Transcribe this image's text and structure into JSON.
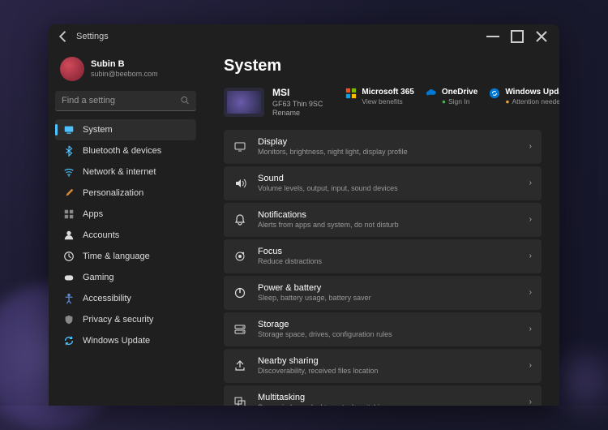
{
  "titlebar": {
    "title": "Settings"
  },
  "profile": {
    "name": "Subin B",
    "email": "subin@beebom.com"
  },
  "search": {
    "placeholder": "Find a setting"
  },
  "sidebar": {
    "items": [
      {
        "icon": "system-icon",
        "label": "System",
        "active": true,
        "color": "#4cc2ff"
      },
      {
        "icon": "bluetooth-icon",
        "label": "Bluetooth & devices",
        "active": false,
        "color": "#4cc2ff"
      },
      {
        "icon": "wifi-icon",
        "label": "Network & internet",
        "active": false,
        "color": "#4cc2ff"
      },
      {
        "icon": "brush-icon",
        "label": "Personalization",
        "active": false,
        "color": "#d68a3a"
      },
      {
        "icon": "apps-icon",
        "label": "Apps",
        "active": false,
        "color": "#888"
      },
      {
        "icon": "accounts-icon",
        "label": "Accounts",
        "active": false,
        "color": "#ddd"
      },
      {
        "icon": "time-icon",
        "label": "Time & language",
        "active": false,
        "color": "#ddd"
      },
      {
        "icon": "gaming-icon",
        "label": "Gaming",
        "active": false,
        "color": "#ddd"
      },
      {
        "icon": "accessibility-icon",
        "label": "Accessibility",
        "active": false,
        "color": "#5a8dd6"
      },
      {
        "icon": "privacy-icon",
        "label": "Privacy & security",
        "active": false,
        "color": "#888"
      },
      {
        "icon": "update-icon",
        "label": "Windows Update",
        "active": false,
        "color": "#4cc2ff"
      }
    ]
  },
  "page": {
    "title": "System"
  },
  "device": {
    "name": "MSI",
    "model": "GF63 Thin 9SC",
    "rename": "Rename"
  },
  "status": [
    {
      "icon": "microsoft-icon",
      "title": "Microsoft 365",
      "sub": "View benefits",
      "dot": ""
    },
    {
      "icon": "onedrive-icon",
      "title": "OneDrive",
      "sub": "Sign In",
      "dot": "green"
    },
    {
      "icon": "update-status-icon",
      "title": "Windows Update",
      "sub": "Attention needed",
      "dot": "amber"
    }
  ],
  "settings": [
    {
      "icon": "display-icon",
      "title": "Display",
      "sub": "Monitors, brightness, night light, display profile"
    },
    {
      "icon": "sound-icon",
      "title": "Sound",
      "sub": "Volume levels, output, input, sound devices"
    },
    {
      "icon": "notifications-icon",
      "title": "Notifications",
      "sub": "Alerts from apps and system, do not disturb"
    },
    {
      "icon": "focus-icon",
      "title": "Focus",
      "sub": "Reduce distractions"
    },
    {
      "icon": "power-icon",
      "title": "Power & battery",
      "sub": "Sleep, battery usage, battery saver"
    },
    {
      "icon": "storage-icon",
      "title": "Storage",
      "sub": "Storage space, drives, configuration rules"
    },
    {
      "icon": "share-icon",
      "title": "Nearby sharing",
      "sub": "Discoverability, received files location"
    },
    {
      "icon": "multitask-icon",
      "title": "Multitasking",
      "sub": "Snap windows, desktops, task switching"
    }
  ]
}
